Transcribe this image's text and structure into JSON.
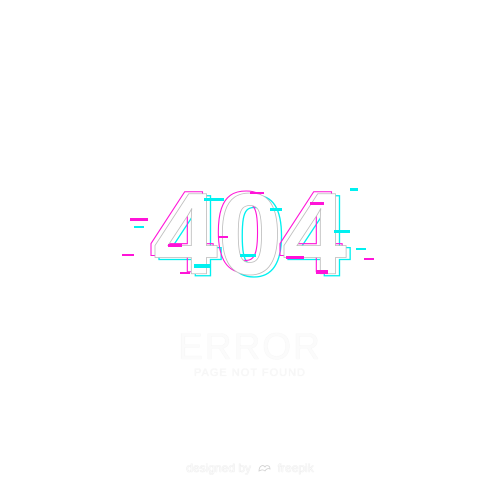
{
  "error_graphic": {
    "code": "404",
    "glitch_colors": {
      "cyan": "#00f0f0",
      "magenta": "#ff14d8",
      "outline": "#b8b8b8",
      "fill": "#ffffff"
    }
  },
  "headline": "ERROR",
  "subheadline": "PAGE NOT FOUND",
  "credit": {
    "prefix": "designed by",
    "brand": "freepik",
    "logo_icon": "freepik-logo-icon"
  }
}
